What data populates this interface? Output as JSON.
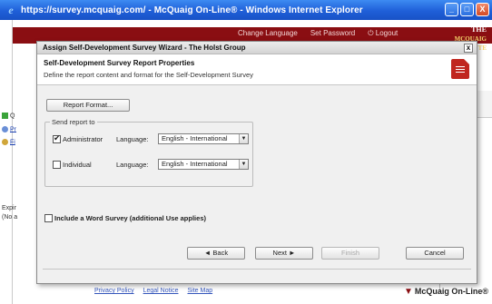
{
  "browser": {
    "title": "https://survey.mcquaig.com/ - McQuaig On-Line® - Windows Internet Explorer",
    "minimize_label": "_",
    "maximize_label": "□",
    "close_label": "X"
  },
  "background_page": {
    "header_links": [
      "Change Language",
      "Set Password",
      "Logout"
    ],
    "logout_icon": "power-icon",
    "brand_lines": [
      "THE",
      "MCQUAIG",
      "INSTITUTE"
    ],
    "side_items": [
      "Q",
      "Pr",
      "Fi"
    ],
    "expiry_text": [
      "Expir",
      "(No a"
    ],
    "footer_links": [
      "Privacy Policy",
      "Legal Notice",
      "Site Map"
    ],
    "footer_logo": "McQuaig On-Line®",
    "colors": {
      "header_bar": "#8a0e12"
    }
  },
  "dialog": {
    "title": "Assign Self-Development Survey Wizard - The Holst Group",
    "close_label": "x",
    "heading": "Self-Development Survey Report Properties",
    "description": "Define the report content and format for the Self-Development Survey",
    "header_icon": "document-icon",
    "report_format_button": "Report Format...",
    "send_report_legend": "Send report to",
    "recipients": [
      {
        "label": "Administrator",
        "checked": true,
        "language_label": "Language:",
        "language_value": "English - International"
      },
      {
        "label": "Individual",
        "checked": false,
        "language_label": "Language:",
        "language_value": "English - International"
      }
    ],
    "word_survey": {
      "label": "Include a Word Survey (additional Use applies)",
      "checked": false
    },
    "buttons": {
      "back": "◄ Back",
      "next": "Next ►",
      "finish": "Finish",
      "cancel": "Cancel"
    }
  }
}
